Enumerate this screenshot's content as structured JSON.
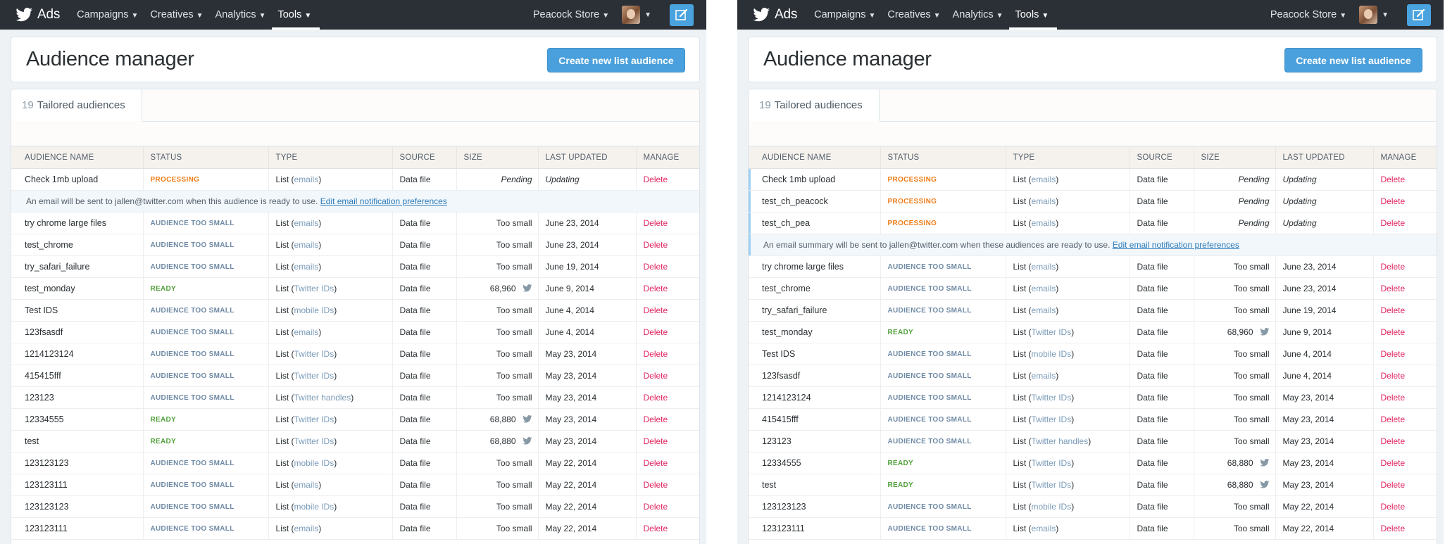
{
  "nav": {
    "brand": "Ads",
    "items": [
      {
        "label": "Campaigns"
      },
      {
        "label": "Creatives"
      },
      {
        "label": "Analytics"
      },
      {
        "label": "Tools"
      }
    ],
    "store": "Peacock Store"
  },
  "header": {
    "title": "Audience manager",
    "create_button": "Create new list audience"
  },
  "tab": {
    "count": "19",
    "label": "Tailored audiences"
  },
  "columns": [
    "AUDIENCE NAME",
    "STATUS",
    "TYPE",
    "SOURCE",
    "SIZE",
    "LAST UPDATED",
    "MANAGE"
  ],
  "panels": [
    {
      "rows": [
        {
          "kind": "row",
          "name": "Check 1mb upload",
          "status": "PROCESSING",
          "status_class": "processing",
          "type_prefix": "List (",
          "type_value": "emails",
          "type_suffix": ")",
          "source": "Data file",
          "size": "Pending",
          "size_icon": false,
          "updated": "Updating",
          "manage": "Delete"
        },
        {
          "kind": "notice",
          "text": "An email will be sent to jallen@twitter.com when this audience is ready to use.",
          "link": "Edit email notification preferences"
        },
        {
          "kind": "row",
          "name": "try chrome large files",
          "status": "AUDIENCE TOO SMALL",
          "status_class": "small",
          "type_prefix": "List (",
          "type_value": "emails",
          "type_suffix": ")",
          "source": "Data file",
          "size": "Too small",
          "size_icon": false,
          "updated": "June 23, 2014",
          "manage": "Delete"
        },
        {
          "kind": "row",
          "name": "test_chrome",
          "status": "AUDIENCE TOO SMALL",
          "status_class": "small",
          "type_prefix": "List (",
          "type_value": "emails",
          "type_suffix": ")",
          "source": "Data file",
          "size": "Too small",
          "size_icon": false,
          "updated": "June 23, 2014",
          "manage": "Delete"
        },
        {
          "kind": "row",
          "name": "try_safari_failure",
          "status": "AUDIENCE TOO SMALL",
          "status_class": "small",
          "type_prefix": "List (",
          "type_value": "emails",
          "type_suffix": ")",
          "source": "Data file",
          "size": "Too small",
          "size_icon": false,
          "updated": "June 19, 2014",
          "manage": "Delete"
        },
        {
          "kind": "row",
          "name": "test_monday",
          "status": "READY",
          "status_class": "ready",
          "type_prefix": "List (",
          "type_value": "Twitter IDs",
          "type_suffix": ")",
          "source": "Data file",
          "size": "68,960",
          "size_icon": true,
          "updated": "June 9, 2014",
          "manage": "Delete"
        },
        {
          "kind": "row",
          "name": "Test IDS",
          "status": "AUDIENCE TOO SMALL",
          "status_class": "small",
          "type_prefix": "List (",
          "type_value": "mobile IDs",
          "type_suffix": ")",
          "source": "Data file",
          "size": "Too small",
          "size_icon": false,
          "updated": "June 4, 2014",
          "manage": "Delete"
        },
        {
          "kind": "row",
          "name": "123fsasdf",
          "status": "AUDIENCE TOO SMALL",
          "status_class": "small",
          "type_prefix": "List (",
          "type_value": "emails",
          "type_suffix": ")",
          "source": "Data file",
          "size": "Too small",
          "size_icon": false,
          "updated": "June 4, 2014",
          "manage": "Delete"
        },
        {
          "kind": "row",
          "name": "1214123124",
          "status": "AUDIENCE TOO SMALL",
          "status_class": "small",
          "type_prefix": "List (",
          "type_value": "Twitter IDs",
          "type_suffix": ")",
          "source": "Data file",
          "size": "Too small",
          "size_icon": false,
          "updated": "May 23, 2014",
          "manage": "Delete"
        },
        {
          "kind": "row",
          "name": "415415fff",
          "status": "AUDIENCE TOO SMALL",
          "status_class": "small",
          "type_prefix": "List (",
          "type_value": "Twitter IDs",
          "type_suffix": ")",
          "source": "Data file",
          "size": "Too small",
          "size_icon": false,
          "updated": "May 23, 2014",
          "manage": "Delete"
        },
        {
          "kind": "row",
          "name": "123123",
          "status": "AUDIENCE TOO SMALL",
          "status_class": "small",
          "type_prefix": "List (",
          "type_value": "Twitter handles",
          "type_suffix": ")",
          "source": "Data file",
          "size": "Too small",
          "size_icon": false,
          "updated": "May 23, 2014",
          "manage": "Delete"
        },
        {
          "kind": "row",
          "name": "12334555",
          "status": "READY",
          "status_class": "ready",
          "type_prefix": "List (",
          "type_value": "Twitter IDs",
          "type_suffix": ")",
          "source": "Data file",
          "size": "68,880",
          "size_icon": true,
          "updated": "May 23, 2014",
          "manage": "Delete"
        },
        {
          "kind": "row",
          "name": "test",
          "status": "READY",
          "status_class": "ready",
          "type_prefix": "List (",
          "type_value": "Twitter IDs",
          "type_suffix": ")",
          "source": "Data file",
          "size": "68,880",
          "size_icon": true,
          "updated": "May 23, 2014",
          "manage": "Delete"
        },
        {
          "kind": "row",
          "name": "123123123",
          "status": "AUDIENCE TOO SMALL",
          "status_class": "small",
          "type_prefix": "List (",
          "type_value": "mobile IDs",
          "type_suffix": ")",
          "source": "Data file",
          "size": "Too small",
          "size_icon": false,
          "updated": "May 22, 2014",
          "manage": "Delete"
        },
        {
          "kind": "row",
          "name": "123123111",
          "status": "AUDIENCE TOO SMALL",
          "status_class": "small",
          "type_prefix": "List (",
          "type_value": "emails",
          "type_suffix": ")",
          "source": "Data file",
          "size": "Too small",
          "size_icon": false,
          "updated": "May 22, 2014",
          "manage": "Delete"
        },
        {
          "kind": "row",
          "name": "123123123",
          "status": "AUDIENCE TOO SMALL",
          "status_class": "small",
          "type_prefix": "List (",
          "type_value": "mobile IDs",
          "type_suffix": ")",
          "source": "Data file",
          "size": "Too small",
          "size_icon": false,
          "updated": "May 22, 2014",
          "manage": "Delete"
        },
        {
          "kind": "row",
          "name": "123123111",
          "status": "AUDIENCE TOO SMALL",
          "status_class": "small",
          "type_prefix": "List (",
          "type_value": "emails",
          "type_suffix": ")",
          "source": "Data file",
          "size": "Too small",
          "size_icon": false,
          "updated": "May 22, 2014",
          "manage": "Delete"
        }
      ]
    },
    {
      "rows": [
        {
          "kind": "row",
          "proc": true,
          "name": "Check 1mb upload",
          "status": "PROCESSING",
          "status_class": "processing",
          "type_prefix": "List (",
          "type_value": "emails",
          "type_suffix": ")",
          "source": "Data file",
          "size": "Pending",
          "size_icon": false,
          "updated": "Updating",
          "manage": "Delete"
        },
        {
          "kind": "row",
          "proc": true,
          "name": "test_ch_peacock",
          "status": "PROCESSING",
          "status_class": "processing",
          "type_prefix": "List (",
          "type_value": "emails",
          "type_suffix": ")",
          "source": "Data file",
          "size": "Pending",
          "size_icon": false,
          "updated": "Updating",
          "manage": "Delete"
        },
        {
          "kind": "row",
          "proc": true,
          "name": "test_ch_pea",
          "status": "PROCESSING",
          "status_class": "processing",
          "type_prefix": "List (",
          "type_value": "emails",
          "type_suffix": ")",
          "source": "Data file",
          "size": "Pending",
          "size_icon": false,
          "updated": "Updating",
          "manage": "Delete"
        },
        {
          "kind": "notice",
          "proc": true,
          "text": "An email summary will be sent to jallen@twitter.com when these audiences are ready to use.",
          "link": "Edit email notification preferences"
        },
        {
          "kind": "row",
          "name": "try chrome large files",
          "status": "AUDIENCE TOO SMALL",
          "status_class": "small",
          "type_prefix": "List (",
          "type_value": "emails",
          "type_suffix": ")",
          "source": "Data file",
          "size": "Too small",
          "size_icon": false,
          "updated": "June 23, 2014",
          "manage": "Delete"
        },
        {
          "kind": "row",
          "name": "test_chrome",
          "status": "AUDIENCE TOO SMALL",
          "status_class": "small",
          "type_prefix": "List (",
          "type_value": "emails",
          "type_suffix": ")",
          "source": "Data file",
          "size": "Too small",
          "size_icon": false,
          "updated": "June 23, 2014",
          "manage": "Delete"
        },
        {
          "kind": "row",
          "name": "try_safari_failure",
          "status": "AUDIENCE TOO SMALL",
          "status_class": "small",
          "type_prefix": "List (",
          "type_value": "emails",
          "type_suffix": ")",
          "source": "Data file",
          "size": "Too small",
          "size_icon": false,
          "updated": "June 19, 2014",
          "manage": "Delete"
        },
        {
          "kind": "row",
          "name": "test_monday",
          "status": "READY",
          "status_class": "ready",
          "type_prefix": "List (",
          "type_value": "Twitter IDs",
          "type_suffix": ")",
          "source": "Data file",
          "size": "68,960",
          "size_icon": true,
          "updated": "June 9, 2014",
          "manage": "Delete"
        },
        {
          "kind": "row",
          "name": "Test IDS",
          "status": "AUDIENCE TOO SMALL",
          "status_class": "small",
          "type_prefix": "List (",
          "type_value": "mobile IDs",
          "type_suffix": ")",
          "source": "Data file",
          "size": "Too small",
          "size_icon": false,
          "updated": "June 4, 2014",
          "manage": "Delete"
        },
        {
          "kind": "row",
          "name": "123fsasdf",
          "status": "AUDIENCE TOO SMALL",
          "status_class": "small",
          "type_prefix": "List (",
          "type_value": "emails",
          "type_suffix": ")",
          "source": "Data file",
          "size": "Too small",
          "size_icon": false,
          "updated": "June 4, 2014",
          "manage": "Delete"
        },
        {
          "kind": "row",
          "name": "1214123124",
          "status": "AUDIENCE TOO SMALL",
          "status_class": "small",
          "type_prefix": "List (",
          "type_value": "Twitter IDs",
          "type_suffix": ")",
          "source": "Data file",
          "size": "Too small",
          "size_icon": false,
          "updated": "May 23, 2014",
          "manage": "Delete"
        },
        {
          "kind": "row",
          "name": "415415fff",
          "status": "AUDIENCE TOO SMALL",
          "status_class": "small",
          "type_prefix": "List (",
          "type_value": "Twitter IDs",
          "type_suffix": ")",
          "source": "Data file",
          "size": "Too small",
          "size_icon": false,
          "updated": "May 23, 2014",
          "manage": "Delete"
        },
        {
          "kind": "row",
          "name": "123123",
          "status": "AUDIENCE TOO SMALL",
          "status_class": "small",
          "type_prefix": "List (",
          "type_value": "Twitter handles",
          "type_suffix": ")",
          "source": "Data file",
          "size": "Too small",
          "size_icon": false,
          "updated": "May 23, 2014",
          "manage": "Delete"
        },
        {
          "kind": "row",
          "name": "12334555",
          "status": "READY",
          "status_class": "ready",
          "type_prefix": "List (",
          "type_value": "Twitter IDs",
          "type_suffix": ")",
          "source": "Data file",
          "size": "68,880",
          "size_icon": true,
          "updated": "May 23, 2014",
          "manage": "Delete"
        },
        {
          "kind": "row",
          "name": "test",
          "status": "READY",
          "status_class": "ready",
          "type_prefix": "List (",
          "type_value": "Twitter IDs",
          "type_suffix": ")",
          "source": "Data file",
          "size": "68,880",
          "size_icon": true,
          "updated": "May 23, 2014",
          "manage": "Delete"
        },
        {
          "kind": "row",
          "name": "123123123",
          "status": "AUDIENCE TOO SMALL",
          "status_class": "small",
          "type_prefix": "List (",
          "type_value": "mobile IDs",
          "type_suffix": ")",
          "source": "Data file",
          "size": "Too small",
          "size_icon": false,
          "updated": "May 22, 2014",
          "manage": "Delete"
        },
        {
          "kind": "row",
          "name": "123123111",
          "status": "AUDIENCE TOO SMALL",
          "status_class": "small",
          "type_prefix": "List (",
          "type_value": "emails",
          "type_suffix": ")",
          "source": "Data file",
          "size": "Too small",
          "size_icon": false,
          "updated": "May 22, 2014",
          "manage": "Delete"
        }
      ]
    }
  ],
  "colors": {
    "nav_bg": "#2b3037",
    "accent_blue": "#4aa0dc",
    "processing": "#f07d18",
    "too_small": "#6f8aa5",
    "ready": "#51a03b",
    "delete": "#e0245e"
  },
  "icons": {
    "brand": "twitter-bird-icon",
    "compose": "compose-tweet-icon",
    "size": "twitter-bird-icon",
    "dropdown": "chevron-down-icon"
  }
}
